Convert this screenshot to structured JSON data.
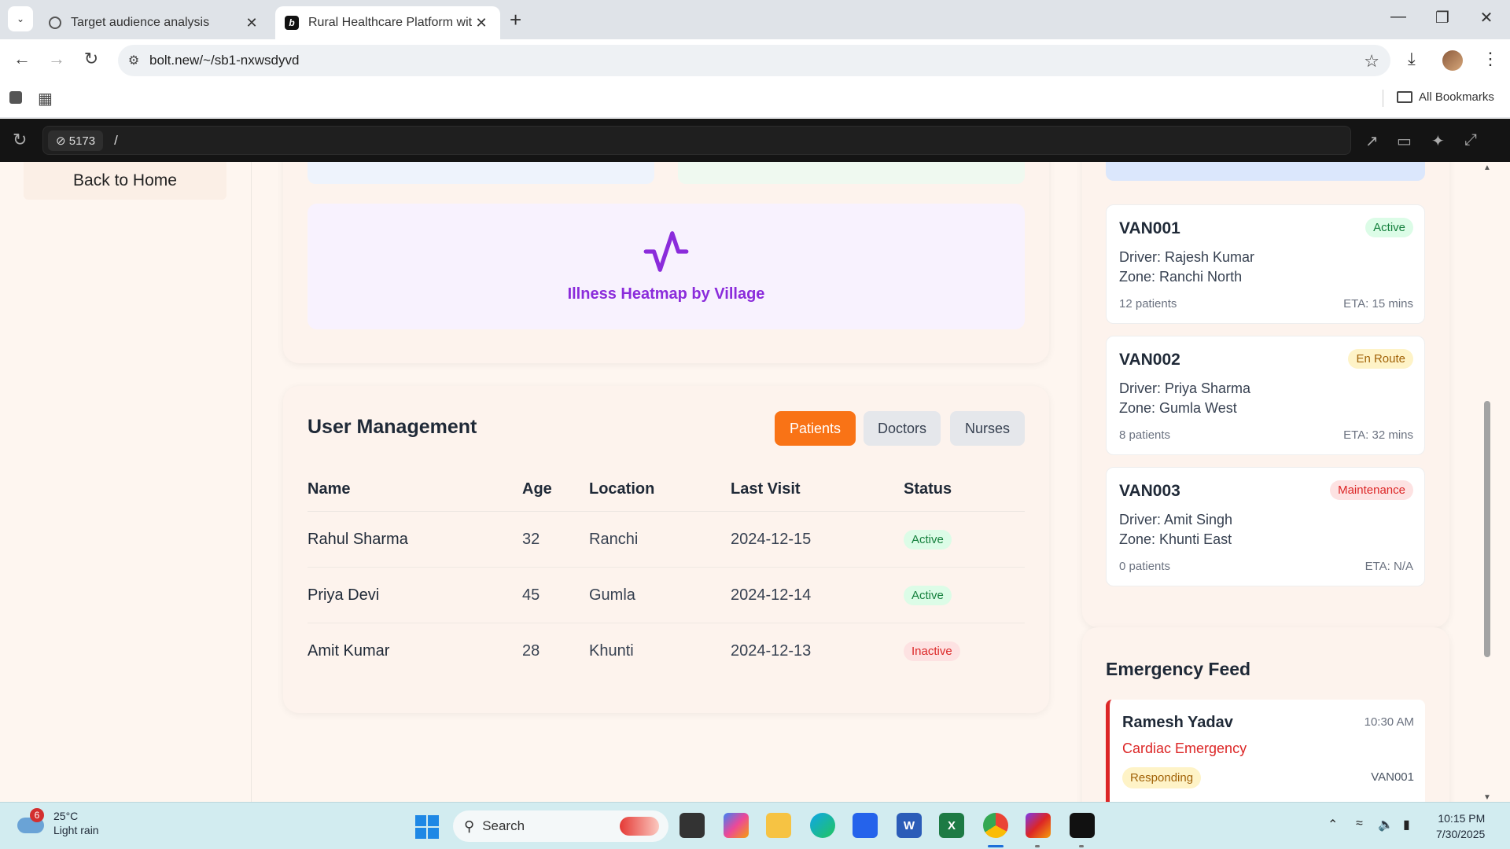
{
  "browser": {
    "tabs": [
      {
        "title": "Target audience analysis",
        "icon": "openai-icon"
      },
      {
        "title": "Rural Healthcare Platform with",
        "icon": "bolt-icon",
        "active": true
      }
    ],
    "url": "bolt.new/~/sb1-nxwsdyvd",
    "bookmarks_label": "All Bookmarks"
  },
  "preview": {
    "port": "5173",
    "path": "/"
  },
  "sidebar": {
    "back_label": "Back to Home"
  },
  "analytics": {
    "heatmap_title": "Illness Heatmap by Village",
    "heatmap_icon": "activity-icon",
    "accent_color": "#8b2cdb"
  },
  "users": {
    "title": "User Management",
    "tabs": [
      "Patients",
      "Doctors",
      "Nurses"
    ],
    "active_tab": "Patients",
    "columns": [
      "Name",
      "Age",
      "Location",
      "Last Visit",
      "Status"
    ],
    "rows": [
      {
        "name": "Rahul Sharma",
        "age": "32",
        "location": "Ranchi",
        "last_visit": "2024-12-15",
        "status": "Active"
      },
      {
        "name": "Priya Devi",
        "age": "45",
        "location": "Gumla",
        "last_visit": "2024-12-14",
        "status": "Active"
      },
      {
        "name": "Amit Kumar",
        "age": "28",
        "location": "Khunti",
        "last_visit": "2024-12-13",
        "status": "Inactive"
      }
    ]
  },
  "vans": [
    {
      "id": "VAN001",
      "status": "Active",
      "driver": "Driver: Rajesh Kumar",
      "zone": "Zone: Ranchi North",
      "patients": "12 patients",
      "eta": "ETA: 15 mins"
    },
    {
      "id": "VAN002",
      "status": "En Route",
      "driver": "Driver: Priya Sharma",
      "zone": "Zone: Gumla West",
      "patients": "8 patients",
      "eta": "ETA: 32 mins"
    },
    {
      "id": "VAN003",
      "status": "Maintenance",
      "driver": "Driver: Amit Singh",
      "zone": "Zone: Khunti East",
      "patients": "0 patients",
      "eta": "ETA: N/A"
    }
  ],
  "emergency": {
    "title": "Emergency Feed",
    "items": [
      {
        "name": "Ramesh Yadav",
        "time": "10:30 AM",
        "type": "Cardiac Emergency",
        "status": "Responding",
        "van": "VAN001"
      }
    ]
  },
  "taskbar": {
    "weather_badge": "6",
    "temperature": "25°C",
    "condition": "Light rain",
    "search_placeholder": "Search",
    "time": "10:15 PM",
    "date": "7/30/2025"
  },
  "colors": {
    "accent_orange": "#f97316",
    "status_green": "#15803d",
    "status_red": "#dc2626",
    "status_yellow": "#a16207"
  }
}
